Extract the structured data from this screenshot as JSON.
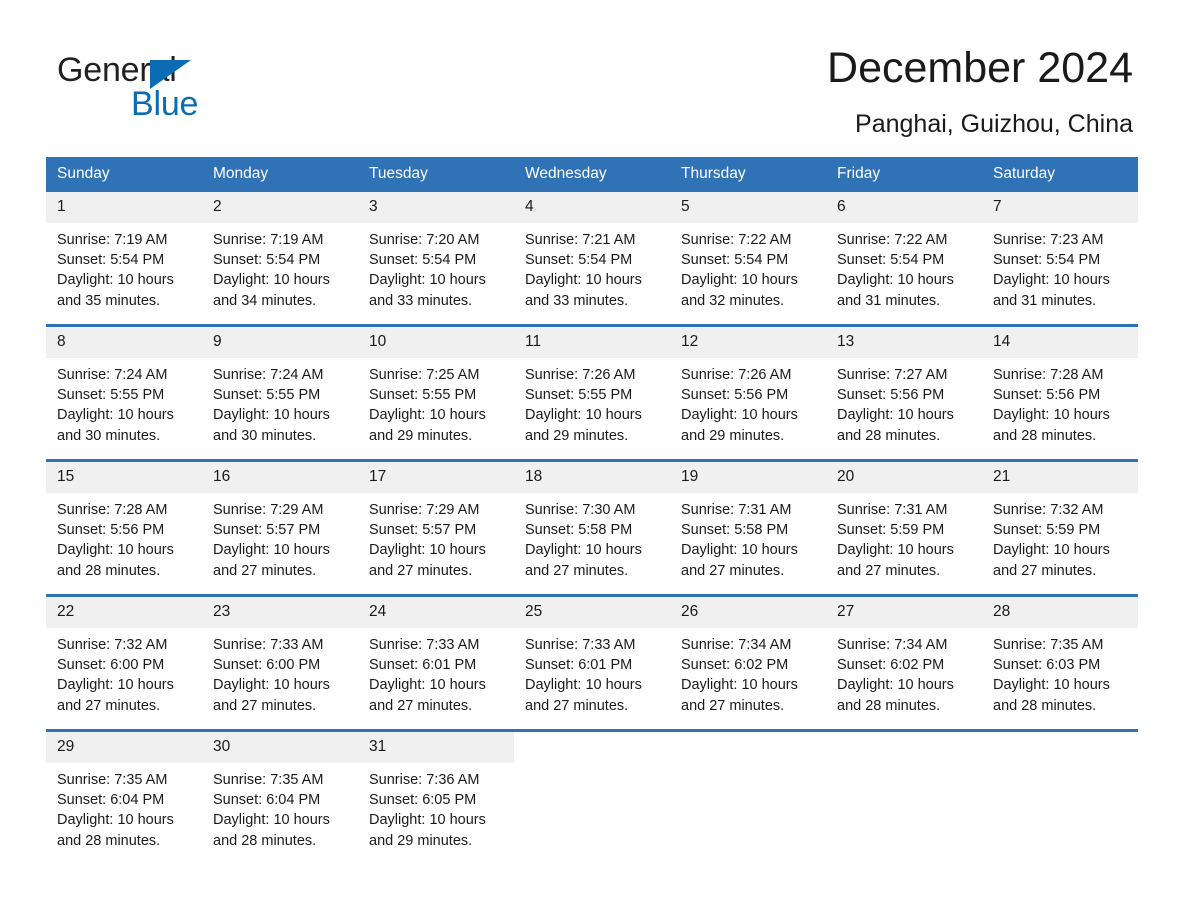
{
  "brand": {
    "name_part1": "General",
    "name_part2": "Blue",
    "logo_icon": "blue-triangle-icon",
    "accent_color": "#0b6cb3"
  },
  "header": {
    "title": "December 2024",
    "location": "Panghai, Guizhou, China"
  },
  "calendar": {
    "header_bg_color": "#2f72b6",
    "date_band_color": "#f0f0f0",
    "weekday_headers": [
      "Sunday",
      "Monday",
      "Tuesday",
      "Wednesday",
      "Thursday",
      "Friday",
      "Saturday"
    ],
    "labels": {
      "sunrise": "Sunrise:",
      "sunset": "Sunset:",
      "daylight": "Daylight:"
    },
    "weeks": [
      [
        {
          "day": "1",
          "sunrise": "Sunrise: 7:19 AM",
          "sunset": "Sunset: 5:54 PM",
          "daylight_line1": "Daylight: 10 hours",
          "daylight_line2": "and 35 minutes."
        },
        {
          "day": "2",
          "sunrise": "Sunrise: 7:19 AM",
          "sunset": "Sunset: 5:54 PM",
          "daylight_line1": "Daylight: 10 hours",
          "daylight_line2": "and 34 minutes."
        },
        {
          "day": "3",
          "sunrise": "Sunrise: 7:20 AM",
          "sunset": "Sunset: 5:54 PM",
          "daylight_line1": "Daylight: 10 hours",
          "daylight_line2": "and 33 minutes."
        },
        {
          "day": "4",
          "sunrise": "Sunrise: 7:21 AM",
          "sunset": "Sunset: 5:54 PM",
          "daylight_line1": "Daylight: 10 hours",
          "daylight_line2": "and 33 minutes."
        },
        {
          "day": "5",
          "sunrise": "Sunrise: 7:22 AM",
          "sunset": "Sunset: 5:54 PM",
          "daylight_line1": "Daylight: 10 hours",
          "daylight_line2": "and 32 minutes."
        },
        {
          "day": "6",
          "sunrise": "Sunrise: 7:22 AM",
          "sunset": "Sunset: 5:54 PM",
          "daylight_line1": "Daylight: 10 hours",
          "daylight_line2": "and 31 minutes."
        },
        {
          "day": "7",
          "sunrise": "Sunrise: 7:23 AM",
          "sunset": "Sunset: 5:54 PM",
          "daylight_line1": "Daylight: 10 hours",
          "daylight_line2": "and 31 minutes."
        }
      ],
      [
        {
          "day": "8",
          "sunrise": "Sunrise: 7:24 AM",
          "sunset": "Sunset: 5:55 PM",
          "daylight_line1": "Daylight: 10 hours",
          "daylight_line2": "and 30 minutes."
        },
        {
          "day": "9",
          "sunrise": "Sunrise: 7:24 AM",
          "sunset": "Sunset: 5:55 PM",
          "daylight_line1": "Daylight: 10 hours",
          "daylight_line2": "and 30 minutes."
        },
        {
          "day": "10",
          "sunrise": "Sunrise: 7:25 AM",
          "sunset": "Sunset: 5:55 PM",
          "daylight_line1": "Daylight: 10 hours",
          "daylight_line2": "and 29 minutes."
        },
        {
          "day": "11",
          "sunrise": "Sunrise: 7:26 AM",
          "sunset": "Sunset: 5:55 PM",
          "daylight_line1": "Daylight: 10 hours",
          "daylight_line2": "and 29 minutes."
        },
        {
          "day": "12",
          "sunrise": "Sunrise: 7:26 AM",
          "sunset": "Sunset: 5:56 PM",
          "daylight_line1": "Daylight: 10 hours",
          "daylight_line2": "and 29 minutes."
        },
        {
          "day": "13",
          "sunrise": "Sunrise: 7:27 AM",
          "sunset": "Sunset: 5:56 PM",
          "daylight_line1": "Daylight: 10 hours",
          "daylight_line2": "and 28 minutes."
        },
        {
          "day": "14",
          "sunrise": "Sunrise: 7:28 AM",
          "sunset": "Sunset: 5:56 PM",
          "daylight_line1": "Daylight: 10 hours",
          "daylight_line2": "and 28 minutes."
        }
      ],
      [
        {
          "day": "15",
          "sunrise": "Sunrise: 7:28 AM",
          "sunset": "Sunset: 5:56 PM",
          "daylight_line1": "Daylight: 10 hours",
          "daylight_line2": "and 28 minutes."
        },
        {
          "day": "16",
          "sunrise": "Sunrise: 7:29 AM",
          "sunset": "Sunset: 5:57 PM",
          "daylight_line1": "Daylight: 10 hours",
          "daylight_line2": "and 27 minutes."
        },
        {
          "day": "17",
          "sunrise": "Sunrise: 7:29 AM",
          "sunset": "Sunset: 5:57 PM",
          "daylight_line1": "Daylight: 10 hours",
          "daylight_line2": "and 27 minutes."
        },
        {
          "day": "18",
          "sunrise": "Sunrise: 7:30 AM",
          "sunset": "Sunset: 5:58 PM",
          "daylight_line1": "Daylight: 10 hours",
          "daylight_line2": "and 27 minutes."
        },
        {
          "day": "19",
          "sunrise": "Sunrise: 7:31 AM",
          "sunset": "Sunset: 5:58 PM",
          "daylight_line1": "Daylight: 10 hours",
          "daylight_line2": "and 27 minutes."
        },
        {
          "day": "20",
          "sunrise": "Sunrise: 7:31 AM",
          "sunset": "Sunset: 5:59 PM",
          "daylight_line1": "Daylight: 10 hours",
          "daylight_line2": "and 27 minutes."
        },
        {
          "day": "21",
          "sunrise": "Sunrise: 7:32 AM",
          "sunset": "Sunset: 5:59 PM",
          "daylight_line1": "Daylight: 10 hours",
          "daylight_line2": "and 27 minutes."
        }
      ],
      [
        {
          "day": "22",
          "sunrise": "Sunrise: 7:32 AM",
          "sunset": "Sunset: 6:00 PM",
          "daylight_line1": "Daylight: 10 hours",
          "daylight_line2": "and 27 minutes."
        },
        {
          "day": "23",
          "sunrise": "Sunrise: 7:33 AM",
          "sunset": "Sunset: 6:00 PM",
          "daylight_line1": "Daylight: 10 hours",
          "daylight_line2": "and 27 minutes."
        },
        {
          "day": "24",
          "sunrise": "Sunrise: 7:33 AM",
          "sunset": "Sunset: 6:01 PM",
          "daylight_line1": "Daylight: 10 hours",
          "daylight_line2": "and 27 minutes."
        },
        {
          "day": "25",
          "sunrise": "Sunrise: 7:33 AM",
          "sunset": "Sunset: 6:01 PM",
          "daylight_line1": "Daylight: 10 hours",
          "daylight_line2": "and 27 minutes."
        },
        {
          "day": "26",
          "sunrise": "Sunrise: 7:34 AM",
          "sunset": "Sunset: 6:02 PM",
          "daylight_line1": "Daylight: 10 hours",
          "daylight_line2": "and 27 minutes."
        },
        {
          "day": "27",
          "sunrise": "Sunrise: 7:34 AM",
          "sunset": "Sunset: 6:02 PM",
          "daylight_line1": "Daylight: 10 hours",
          "daylight_line2": "and 28 minutes."
        },
        {
          "day": "28",
          "sunrise": "Sunrise: 7:35 AM",
          "sunset": "Sunset: 6:03 PM",
          "daylight_line1": "Daylight: 10 hours",
          "daylight_line2": "and 28 minutes."
        }
      ],
      [
        {
          "day": "29",
          "sunrise": "Sunrise: 7:35 AM",
          "sunset": "Sunset: 6:04 PM",
          "daylight_line1": "Daylight: 10 hours",
          "daylight_line2": "and 28 minutes."
        },
        {
          "day": "30",
          "sunrise": "Sunrise: 7:35 AM",
          "sunset": "Sunset: 6:04 PM",
          "daylight_line1": "Daylight: 10 hours",
          "daylight_line2": "and 28 minutes."
        },
        {
          "day": "31",
          "sunrise": "Sunrise: 7:36 AM",
          "sunset": "Sunset: 6:05 PM",
          "daylight_line1": "Daylight: 10 hours",
          "daylight_line2": "and 29 minutes."
        },
        {
          "day": "",
          "sunrise": "",
          "sunset": "",
          "daylight_line1": "",
          "daylight_line2": ""
        },
        {
          "day": "",
          "sunrise": "",
          "sunset": "",
          "daylight_line1": "",
          "daylight_line2": ""
        },
        {
          "day": "",
          "sunrise": "",
          "sunset": "",
          "daylight_line1": "",
          "daylight_line2": ""
        },
        {
          "day": "",
          "sunrise": "",
          "sunset": "",
          "daylight_line1": "",
          "daylight_line2": ""
        }
      ]
    ]
  }
}
